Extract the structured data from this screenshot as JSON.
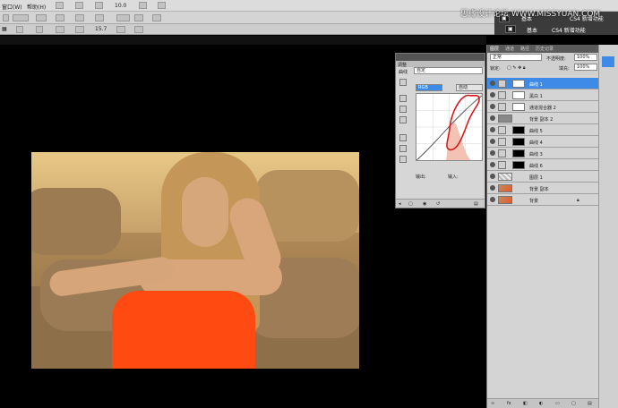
{
  "menubar": {
    "items": [
      "窗口(W)",
      "帮助(H)"
    ],
    "workspace_tabs": [
      "基本",
      "CS4 新增功能"
    ],
    "option_values": [
      "10.0",
      "15.7"
    ]
  },
  "watermark": "思缘设计论坛 WWW.MISSYUAN.COM",
  "adjustments": {
    "tabs": [
      "调整"
    ],
    "title": "曲线",
    "preset": "自定",
    "channel": "RGB",
    "auto_button": "自动",
    "output_label": "输出:",
    "input_label": "输入:"
  },
  "layers": {
    "tabs": [
      "图层",
      "通道",
      "路径",
      "历史记录"
    ],
    "blend_mode": "正常",
    "opacity_label": "不透明度:",
    "opacity": "100%",
    "lock_label": "锁定:",
    "fill_label": "填充:",
    "fill": "100%",
    "items": [
      {
        "name": "曲线 1",
        "active": true
      },
      {
        "name": "黑白 1",
        "active": false
      },
      {
        "name": "通道混合器 2",
        "active": false
      },
      {
        "name": "背景 副本 2",
        "active": false
      },
      {
        "name": "曲线 5",
        "active": false
      },
      {
        "name": "曲线 4",
        "active": false
      },
      {
        "name": "曲线 3",
        "active": false
      },
      {
        "name": "曲线 6",
        "active": false
      },
      {
        "name": "图层 1",
        "active": false
      },
      {
        "name": "背景 副本",
        "active": false
      },
      {
        "name": "背景",
        "active": false
      }
    ]
  },
  "colors": {
    "accent": "#3d8be6",
    "annotation": "#d4151a",
    "dress": "#ff4a12"
  }
}
